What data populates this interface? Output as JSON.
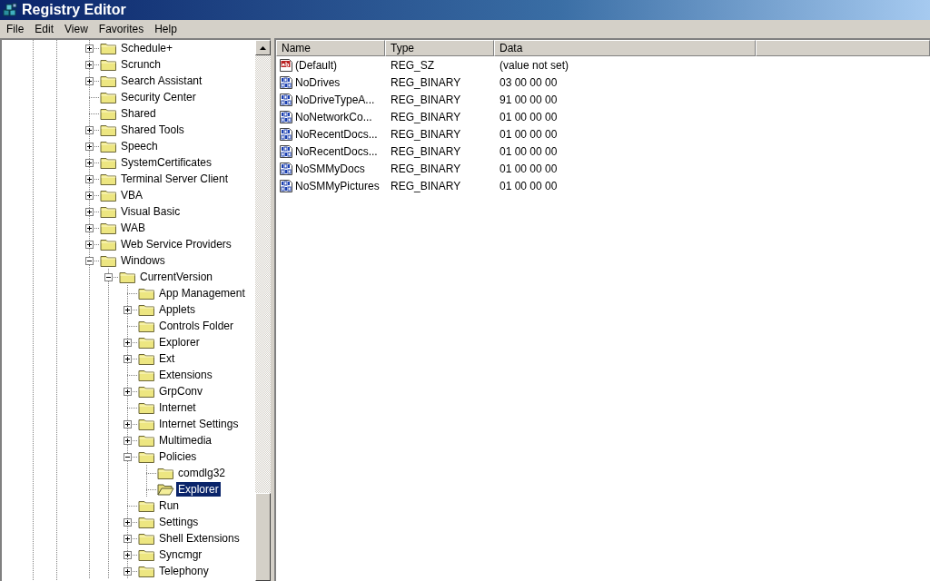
{
  "window": {
    "title": "Registry Editor"
  },
  "menu": [
    "File",
    "Edit",
    "View",
    "Favorites",
    "Help"
  ],
  "tree": [
    {
      "label": "Schedule+",
      "expanded": false,
      "selected": false
    },
    {
      "label": "Scrunch",
      "expanded": false,
      "selected": false
    },
    {
      "label": "Search Assistant",
      "expanded": false,
      "selected": false
    },
    {
      "label": "Security Center",
      "selected": false
    },
    {
      "label": "Shared",
      "selected": false
    },
    {
      "label": "Shared Tools",
      "expanded": false,
      "selected": false
    },
    {
      "label": "Speech",
      "expanded": false,
      "selected": false
    },
    {
      "label": "SystemCertificates",
      "expanded": false,
      "selected": false
    },
    {
      "label": "Terminal Server Client",
      "expanded": false,
      "selected": false
    },
    {
      "label": "VBA",
      "expanded": false,
      "selected": false
    },
    {
      "label": "Visual Basic",
      "expanded": false,
      "selected": false
    },
    {
      "label": "WAB",
      "expanded": false,
      "selected": false
    },
    {
      "label": "Web Service Providers",
      "expanded": false,
      "selected": false
    },
    {
      "label": "Windows",
      "expanded": true,
      "selected": false,
      "children": [
        {
          "label": "CurrentVersion",
          "expanded": true,
          "selected": false,
          "children": [
            {
              "label": "App Management",
              "selected": false
            },
            {
              "label": "Applets",
              "expanded": false,
              "selected": false
            },
            {
              "label": "Controls Folder",
              "selected": false
            },
            {
              "label": "Explorer",
              "expanded": false,
              "selected": false
            },
            {
              "label": "Ext",
              "expanded": false,
              "selected": false
            },
            {
              "label": "Extensions",
              "selected": false
            },
            {
              "label": "GrpConv",
              "expanded": false,
              "selected": false
            },
            {
              "label": "Internet",
              "selected": false
            },
            {
              "label": "Internet Settings",
              "expanded": false,
              "selected": false
            },
            {
              "label": "Multimedia",
              "expanded": false,
              "selected": false
            },
            {
              "label": "Policies",
              "expanded": true,
              "selected": false,
              "children": [
                {
                  "label": "comdlg32",
                  "selected": false
                },
                {
                  "label": "Explorer",
                  "selected": true
                }
              ]
            },
            {
              "label": "Run",
              "selected": false
            },
            {
              "label": "Settings",
              "expanded": false,
              "selected": false
            },
            {
              "label": "Shell Extensions",
              "expanded": false,
              "selected": false
            },
            {
              "label": "Syncmgr",
              "expanded": false,
              "selected": false
            },
            {
              "label": "Telephony",
              "expanded": false,
              "selected": false
            }
          ]
        }
      ]
    }
  ],
  "list": {
    "columns": [
      "Name",
      "Type",
      "Data"
    ],
    "rows": [
      {
        "kind": "string",
        "name": "(Default)",
        "type": "REG_SZ",
        "data": "(value not set)"
      },
      {
        "kind": "binary",
        "name": "NoDrives",
        "type": "REG_BINARY",
        "data": "03 00 00 00"
      },
      {
        "kind": "binary",
        "name": "NoDriveTypeA...",
        "type": "REG_BINARY",
        "data": "91 00 00 00"
      },
      {
        "kind": "binary",
        "name": "NoNetworkCo...",
        "type": "REG_BINARY",
        "data": "01 00 00 00"
      },
      {
        "kind": "binary",
        "name": "NoRecentDocs...",
        "type": "REG_BINARY",
        "data": "01 00 00 00"
      },
      {
        "kind": "binary",
        "name": "NoRecentDocs...",
        "type": "REG_BINARY",
        "data": "01 00 00 00"
      },
      {
        "kind": "binary",
        "name": "NoSMMyDocs",
        "type": "REG_BINARY",
        "data": "01 00 00 00"
      },
      {
        "kind": "binary",
        "name": "NoSMMyPictures",
        "type": "REG_BINARY",
        "data": "01 00 00 00"
      }
    ]
  }
}
